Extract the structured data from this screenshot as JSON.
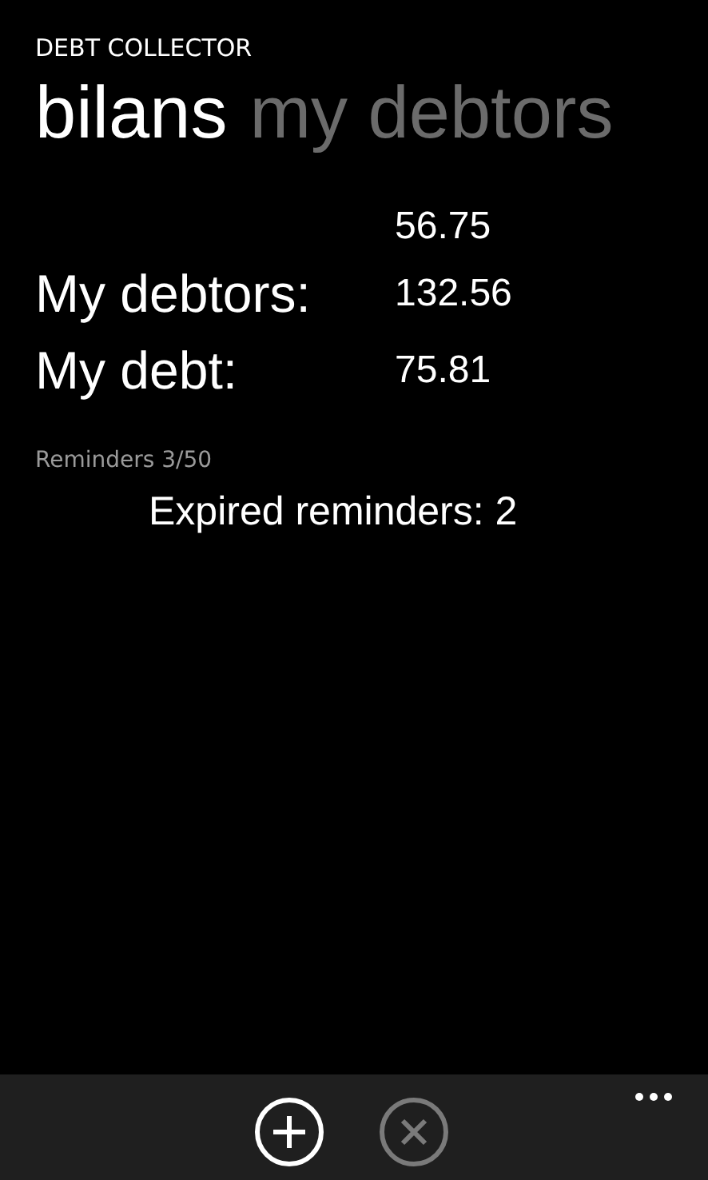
{
  "app_title": "DEBT COLLECTOR",
  "pivot_tabs": [
    {
      "label": "bilans",
      "selected": true
    },
    {
      "label": "my debtors",
      "selected": false
    }
  ],
  "summary_rows": [
    {
      "value": "56.75"
    },
    {
      "label": "My debtors:",
      "value": "132.56"
    },
    {
      "label": "My debt:",
      "value": "75.81"
    }
  ],
  "reminders_count": "Reminders 3/50",
  "expired_reminders": "Expired reminders: 2",
  "app_bar": {
    "buttons": [
      {
        "kind": "add",
        "disabled": false
      },
      {
        "kind": "cancel",
        "disabled": true
      }
    ]
  }
}
